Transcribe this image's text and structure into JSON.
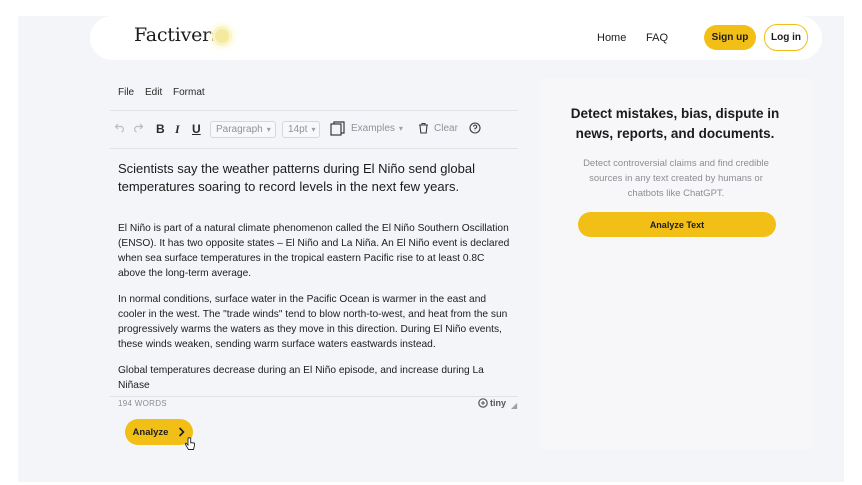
{
  "nav": {
    "logo": "Factiverse",
    "links": [
      "Home",
      "FAQ"
    ],
    "signup": "Sign up",
    "login": "Log in"
  },
  "editor": {
    "menu": [
      "File",
      "Edit",
      "Format"
    ],
    "toolbar": {
      "bold": "B",
      "italic": "I",
      "underline": "U",
      "block_format": "Paragraph",
      "font_size": "14pt",
      "examples": "Examples",
      "clear": "Clear",
      "help": "?"
    },
    "title": "Scientists say the weather patterns during El Niño send global temperatures soaring to record levels in the next few years.",
    "paragraphs": [
      "El Niño is part of a natural climate phenomenon called the El Niño Southern Oscillation (ENSO). It has two opposite states – El Niño and La Niña. An El Niño event is declared when sea surface temperatures in the tropical eastern Pacific rise to at least 0.8C above the long-term average.",
      "In normal conditions, surface water in the Pacific Ocean is warmer in the east and cooler in the west. The \"trade winds\" tend to blow north-to-west, and heat from the sun progressively warms the waters as they move in this direction. During El Niño events, these winds weaken, sending warm surface waters eastwards instead.",
      "Global temperatures decrease during an El Niño episode, and increase during La Niñase"
    ],
    "word_count": "194 WORDS",
    "branding": "tiny",
    "analyze_button": "Analyze"
  },
  "panel": {
    "heading": "Detect mistakes, bias, dispute in news, reports, and documents.",
    "description": "Detect controversial claims and find credible sources in any text created by humans or chatbots like ChatGPT.",
    "button": "Analyze Text"
  },
  "colors": {
    "accent": "#f2bf17",
    "background": "#f4f5f8",
    "muted_text": "#8b8e94"
  }
}
